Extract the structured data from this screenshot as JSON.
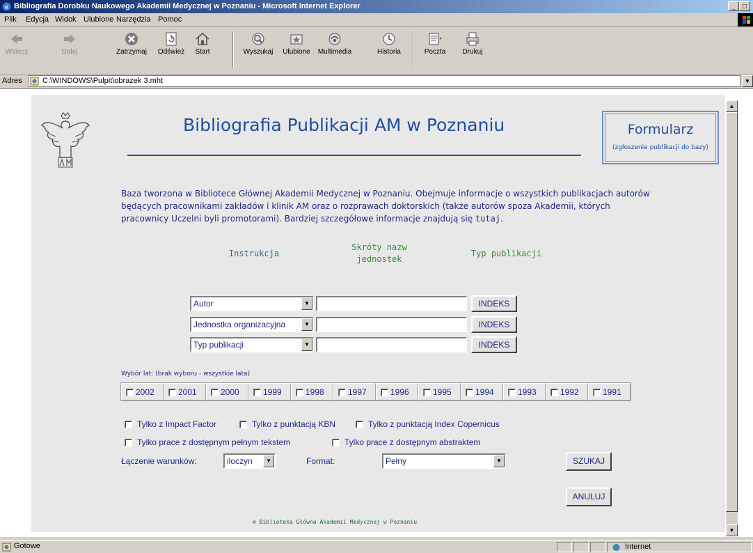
{
  "window": {
    "title": "Bibliografia Dorobku Naukowego Akademii Medycznej w Poznaniu - Microsoft Internet Explorer",
    "controls": [
      "_",
      "□"
    ]
  },
  "menu": [
    "Plik",
    "Edycja",
    "Widok",
    "Ulubione",
    "Narzędzia",
    "Pomoc"
  ],
  "toolbar": {
    "buttons": [
      {
        "label": "Wstecz",
        "icon": "back-arrow-icon",
        "enabled": false
      },
      {
        "label": "Dalej",
        "icon": "forward-arrow-icon",
        "enabled": false
      },
      {
        "label": "Zatrzymaj",
        "icon": "stop-icon",
        "enabled": true
      },
      {
        "label": "Odśwież",
        "icon": "refresh-icon",
        "enabled": true
      },
      {
        "label": "Start",
        "icon": "home-icon",
        "enabled": true
      },
      {
        "label": "Wyszukaj",
        "icon": "search-icon",
        "enabled": true
      },
      {
        "label": "Ulubione",
        "icon": "favorites-icon",
        "enabled": true
      },
      {
        "label": "Multimedia",
        "icon": "media-icon",
        "enabled": true
      },
      {
        "label": "Historia",
        "icon": "history-icon",
        "enabled": true
      },
      {
        "label": "Poczta",
        "icon": "mail-icon",
        "enabled": true
      },
      {
        "label": "Drukuj",
        "icon": "print-icon",
        "enabled": true
      }
    ]
  },
  "address": {
    "label": "Adres",
    "value": "C:\\WINDOWS\\Pulpit\\obrazek 3.mht"
  },
  "page": {
    "title": "Bibliografia Publikacji AM w Poznaniu",
    "form_box": {
      "title": "Formularz",
      "subtitle": "(zgłoszenie publikacji do bazy)"
    },
    "description": "Baza tworzona w Bibliotece Głównej Akademii Medycznej w Poznaniu. Obejmuje informacje o wszystkich publikacjach autorów będących pracownikami zakładów i klinik AM oraz o rozprawach doktorskich (także autorów spoza Akademii, których pracownicy Uczelni byli promotorami). Bardziej szczegółowe informacje znajdują się",
    "description_link": "tutaj",
    "description_end": ".",
    "links": {
      "instrukcja": "Instrukcja",
      "skroty_line1": "Skróty nazw",
      "skroty_line2": "jednostek",
      "typ": "Typ publikacji"
    },
    "search_rows": [
      {
        "field": "Autor",
        "value": "",
        "button": "INDEKS"
      },
      {
        "field": "Jednostka organizacyjna",
        "value": "",
        "button": "INDEKS"
      },
      {
        "field": "Typ publikacji",
        "value": "",
        "button": "INDEKS"
      }
    ],
    "year_label": "Wybór lat: (brak wyboru - wszystkie lata)",
    "years": [
      "2002",
      "2001",
      "2000",
      "1999",
      "1998",
      "1997",
      "1996",
      "1995",
      "1994",
      "1993",
      "1992",
      "1991"
    ],
    "options": {
      "impact_factor": "Tylko z Impact Factor",
      "kbn": "Tylko z punktacją KBN",
      "copernicus": "Tylko z punktacją Index Copernicus",
      "fulltext": "Tylko prace z dostępnym pełnym tekstem",
      "abstract": "Tylko prace z dostępnym abstraktem"
    },
    "join_label": "Łączenie warunków:",
    "join_value": "iloczyn",
    "format_label": "Format:",
    "format_value": "Pełny",
    "search_button": "SZUKAJ",
    "cancel_button": "ANULUJ",
    "footer_symbol": "©",
    "footer": "Biblioteka Główna Akademii Medycznej w Poznaniu"
  },
  "status": {
    "text": "Gotowe",
    "zone": "Internet"
  },
  "colors": {
    "heading": "#1f4ea0",
    "link_green": "#3a8a3a",
    "link_teal": "#2a6f7a",
    "page_bg": "#e8e8e8",
    "titlebar": "#0a246a"
  }
}
